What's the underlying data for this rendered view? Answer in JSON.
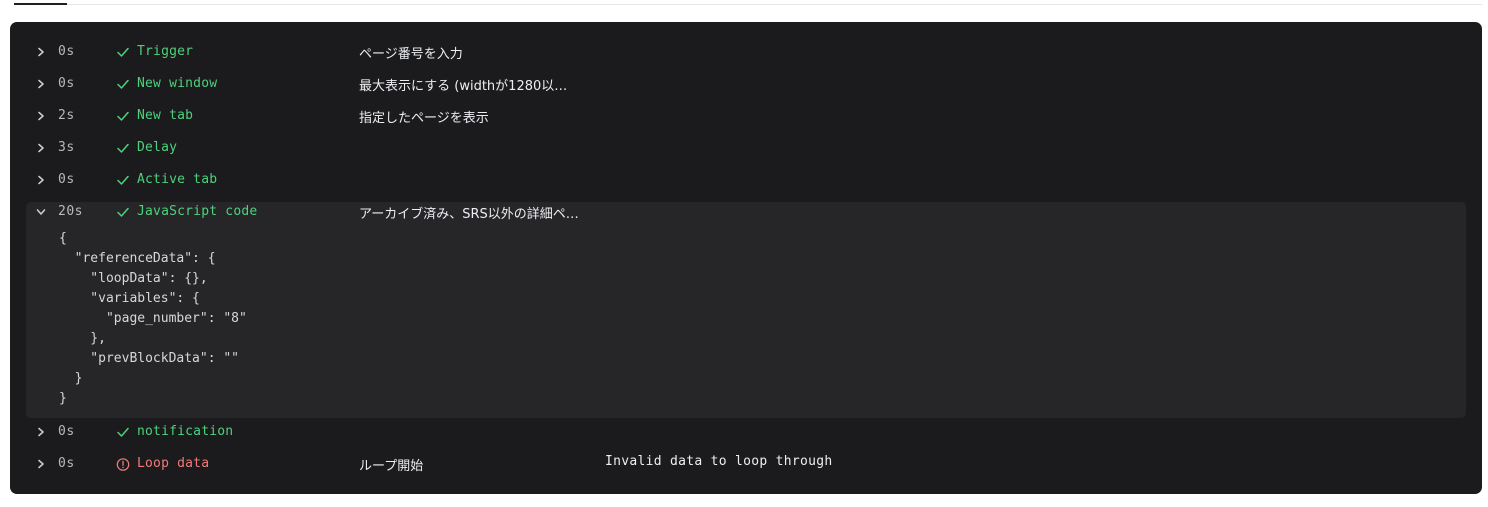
{
  "log": {
    "entries": [
      {
        "duration": "0s",
        "name": "Trigger",
        "status": "success",
        "description": "ページ番号を入力",
        "message": "",
        "expanded": false
      },
      {
        "duration": "0s",
        "name": "New window",
        "status": "success",
        "description": "最大表示にする (widthが1280以…",
        "message": "",
        "expanded": false
      },
      {
        "duration": "2s",
        "name": "New tab",
        "status": "success",
        "description": "指定したページを表示",
        "message": "",
        "expanded": false
      },
      {
        "duration": "3s",
        "name": "Delay",
        "status": "success",
        "description": "",
        "message": "",
        "expanded": false
      },
      {
        "duration": "0s",
        "name": "Active tab",
        "status": "success",
        "description": "",
        "message": "",
        "expanded": false
      },
      {
        "duration": "20s",
        "name": "JavaScript code",
        "status": "success",
        "description": "アーカイブ済み、SRS以外の詳細ペ…",
        "message": "",
        "expanded": true,
        "detail": "{\n  \"referenceData\": {\n    \"loopData\": {},\n    \"variables\": {\n      \"page_number\": \"8\"\n    },\n    \"prevBlockData\": \"\"\n  }\n}"
      },
      {
        "duration": "0s",
        "name": "notification",
        "status": "success",
        "description": "",
        "message": "",
        "expanded": false
      },
      {
        "duration": "0s",
        "name": "Loop data",
        "status": "error",
        "description": "ループ開始",
        "message": "Invalid data to loop through",
        "expanded": false
      }
    ]
  },
  "icons": {
    "chevron_right": "chevron-right-icon",
    "chevron_down": "chevron-down-icon",
    "success": "check-icon",
    "error": "error-circle-icon"
  },
  "colors": {
    "panel_bg": "#1b1b1d",
    "expanded_bg": "#262629",
    "success": "#4ed07c",
    "error": "#f07a7a",
    "text": "#eceef1",
    "muted": "#b8b9bd"
  }
}
